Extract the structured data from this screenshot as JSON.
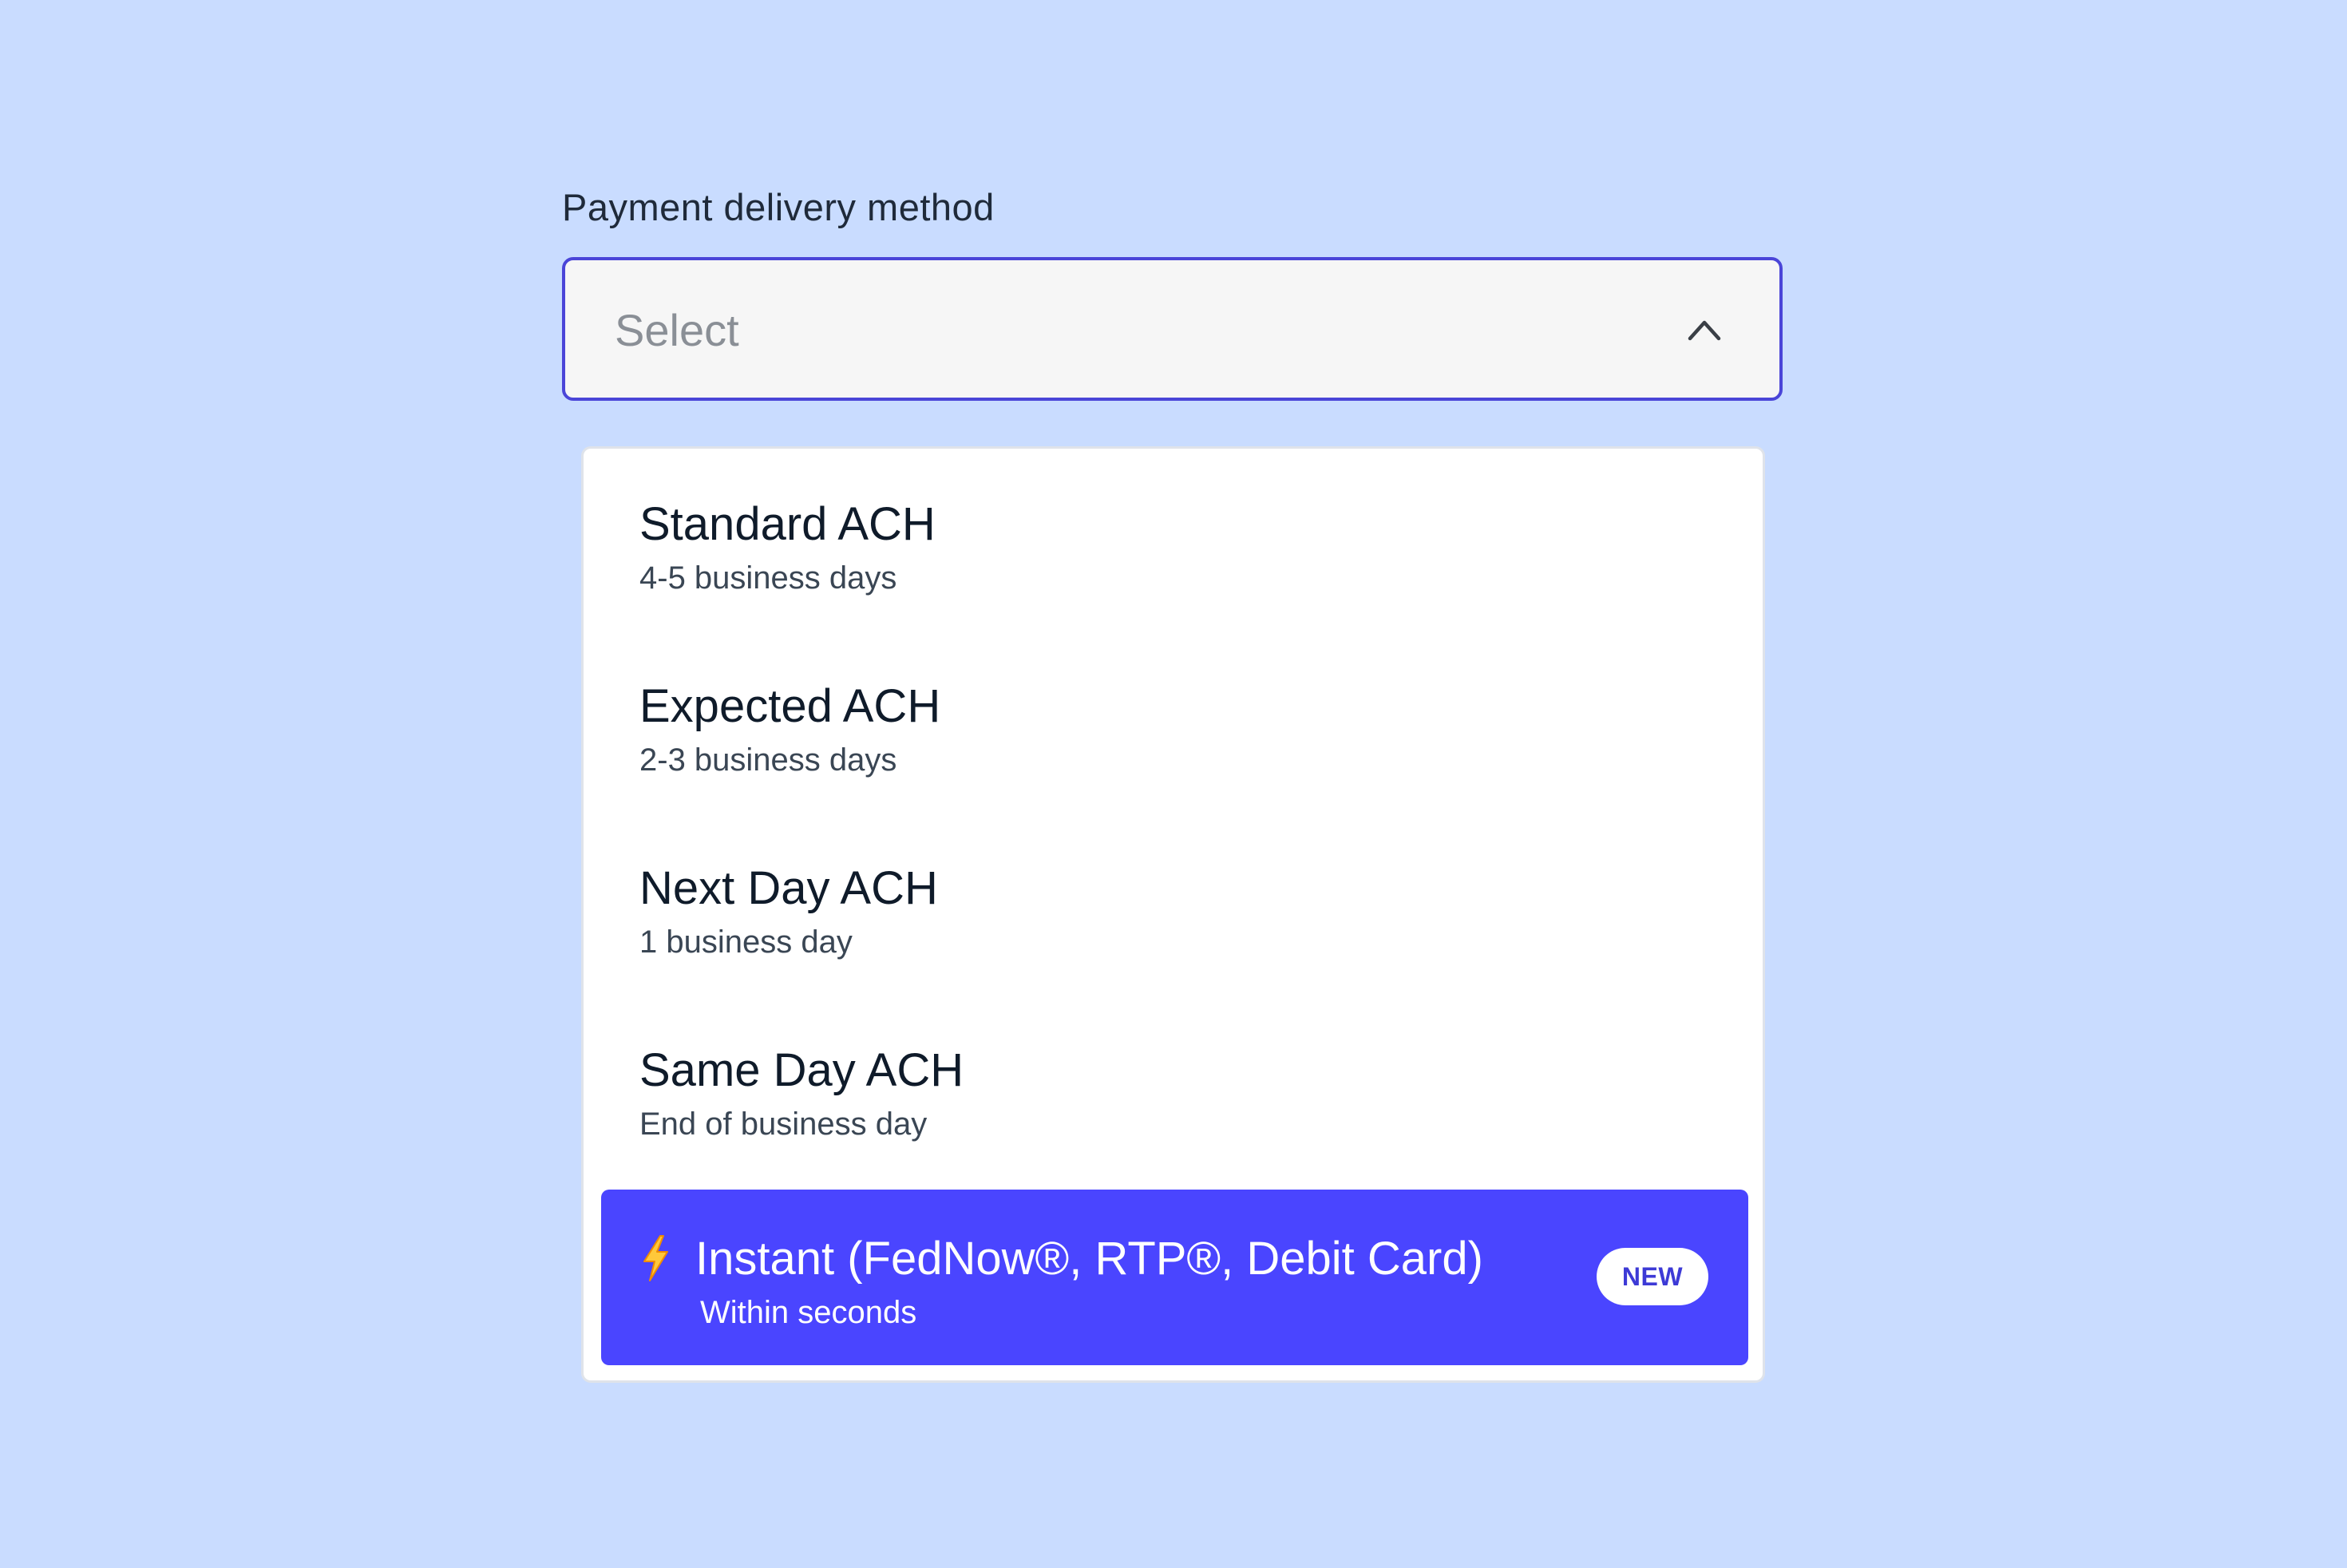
{
  "field": {
    "label": "Payment delivery method",
    "placeholder": "Select",
    "toggle_icon": "chevron-up-icon"
  },
  "colors": {
    "background": "#c9dcff",
    "accent": "#4a45ff",
    "focus_border": "#4a45d8",
    "badge_text": "#3d3ad6"
  },
  "options": [
    {
      "title": "Standard ACH",
      "subtitle": "4-5 business days"
    },
    {
      "title": "Expected ACH",
      "subtitle": "2-3 business days"
    },
    {
      "title": "Next Day ACH",
      "subtitle": "1 business day"
    },
    {
      "title": "Same Day ACH",
      "subtitle": "End of business day"
    },
    {
      "icon": "lightning-bolt-icon",
      "title": "Instant (FedNow®, RTP®, Debit Card)",
      "subtitle": "Within seconds",
      "badge": "NEW",
      "highlighted": true
    }
  ]
}
